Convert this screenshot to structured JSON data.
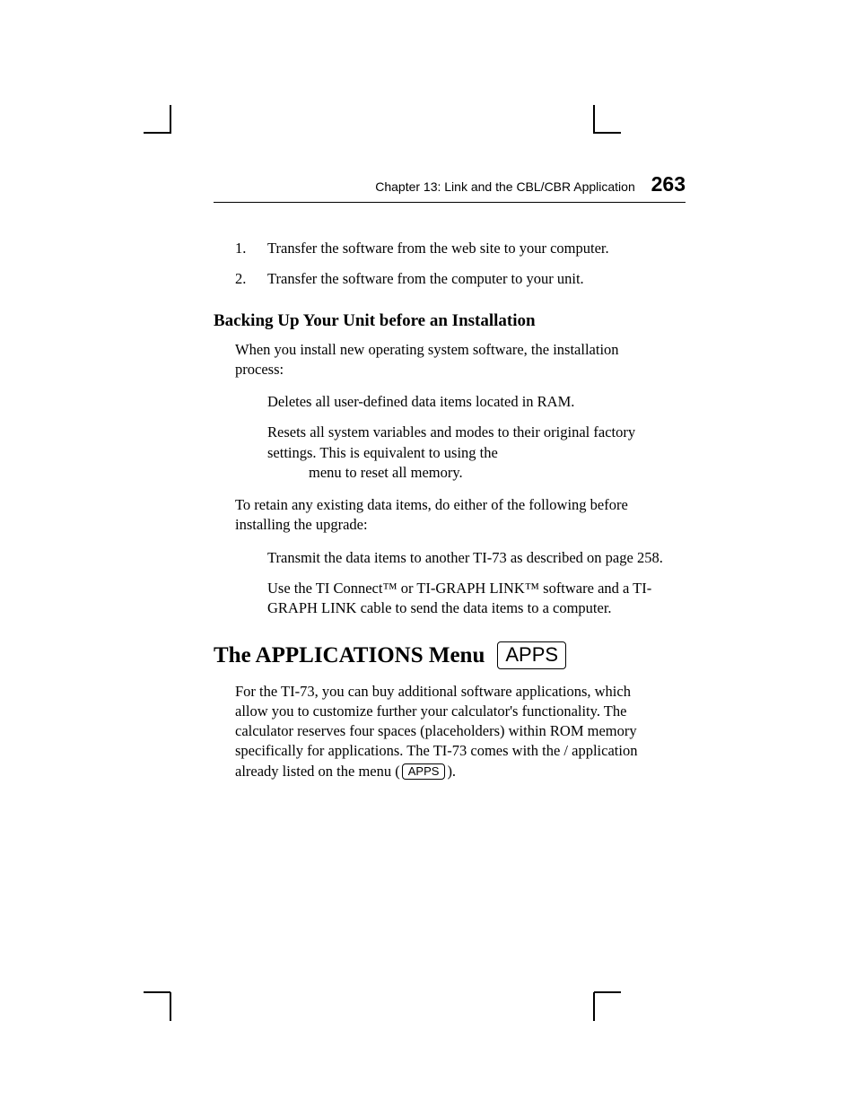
{
  "header": {
    "chapter_line": "Chapter 13: Link and the CBL/CBR Application",
    "page_number": "263"
  },
  "steps": [
    {
      "num": "1.",
      "text": "Transfer the software from the web site to your computer."
    },
    {
      "num": "2.",
      "text": "Transfer the software from the computer to your unit."
    }
  ],
  "backup_heading": "Backing Up Your Unit before an Installation",
  "backup_intro": "When you install new operating system software, the installation process:",
  "backup_bullets": [
    {
      "line1": "Deletes all user-defined data items located in RAM."
    },
    {
      "line1": "Resets all system variables and modes to their original factory settings. This is equivalent to using the",
      "line2": " menu to reset all memory."
    }
  ],
  "retain_intro": "To retain any existing data items, do either of the following before installing the upgrade:",
  "retain_bullets": [
    "Transmit the data items to another TI-73 as described on page 258.",
    "Use the TI Connect™ or TI-GRAPH LINK™ software and a TI-GRAPH LINK cable to send the data items to a computer."
  ],
  "apps_heading": "The APPLICATIONS Menu",
  "apps_key_big": "APPS",
  "apps_para_1": "For the TI-73, you can buy additional software applications, which allow you to customize further your calculator's functionality. The calculator reserves four spaces (placeholders) within ROM memory specifically for applications. The TI-73 comes with the ",
  "apps_para_app_left": "",
  "apps_para_slash": "/",
  "apps_para_app_right": "",
  "apps_para_2": " application already listed on the ",
  "apps_para_menu_word": "",
  "apps_para_3": " menu (",
  "apps_key_small": "APPS",
  "apps_para_4": ")."
}
